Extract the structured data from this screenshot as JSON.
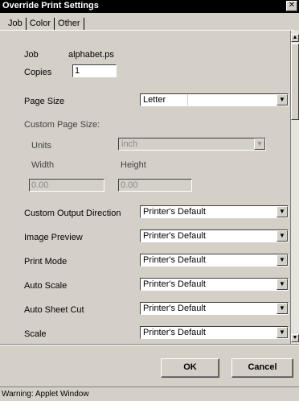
{
  "window": {
    "title": "Override Print Settings",
    "close_glyph": "✕"
  },
  "tabs": [
    {
      "label": "Job"
    },
    {
      "label": "Color"
    },
    {
      "label": "Other"
    }
  ],
  "job": {
    "label": "Job",
    "value": "alphabet.ps"
  },
  "copies": {
    "label": "Copies",
    "value": "1"
  },
  "page_size": {
    "label": "Page Size",
    "value": "Letter"
  },
  "custom_page_size": {
    "label": "Custom Page Size:",
    "units_label": "Units",
    "units_value": "inch",
    "width_label": "Width",
    "width_value": "0.00",
    "height_label": "Height",
    "height_value": "0.00"
  },
  "options": [
    {
      "label": "Custom Output Direction",
      "value": "Printer's Default"
    },
    {
      "label": "Image Preview",
      "value": "Printer's Default"
    },
    {
      "label": "Print Mode",
      "value": "Printer's Default"
    },
    {
      "label": "Auto Scale",
      "value": "Printer's Default"
    },
    {
      "label": "Auto Sheet Cut",
      "value": "Printer's Default"
    },
    {
      "label": "Scale",
      "value": "Printer's Default"
    }
  ],
  "buttons": {
    "ok": "OK",
    "cancel": "Cancel"
  },
  "status": {
    "message": "Warning: Applet Window"
  },
  "icons": {
    "dropdown": "chevron-down-icon",
    "scroll_up": "arrow-up-icon",
    "scroll_down": "arrow-down-icon"
  }
}
